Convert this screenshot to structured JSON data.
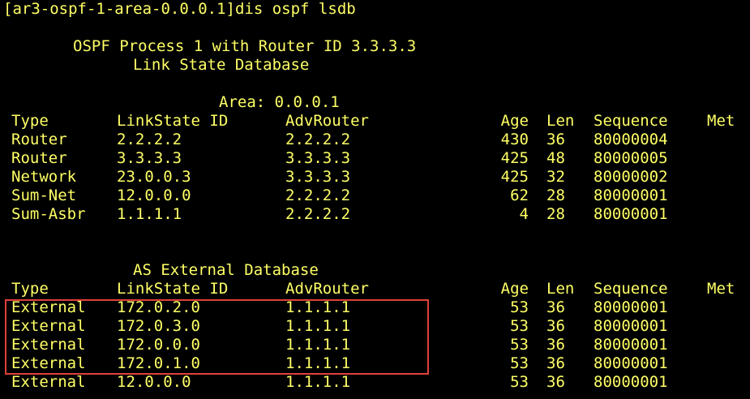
{
  "terminal": {
    "prompt": "[ar3-ospf-1-area-0.0.0.1]",
    "command": "dis ospf lsdb",
    "title_line": "OSPF Process 1 with Router ID 3.3.3.3",
    "subtitle_line": "Link State Database",
    "area_label": "Area:",
    "area_value": "0.0.0.1",
    "external_title": "AS External Database",
    "colors": {
      "background": "#000000",
      "text": "#ffff66",
      "highlight_border": "#e0403a"
    }
  },
  "columns": {
    "type": "Type",
    "lsid": "LinkState ID",
    "adv": "AdvRouter",
    "age": "Age",
    "len": "Len",
    "seq": "Sequence",
    "met": "Met"
  },
  "area_rows": [
    {
      "type": "Router",
      "lsid": "2.2.2.2",
      "adv": "2.2.2.2",
      "age": "430",
      "len": "36",
      "seq": "80000004"
    },
    {
      "type": "Router",
      "lsid": "3.3.3.3",
      "adv": "3.3.3.3",
      "age": "425",
      "len": "48",
      "seq": "80000005"
    },
    {
      "type": "Network",
      "lsid": "23.0.0.3",
      "adv": "3.3.3.3",
      "age": "425",
      "len": "32",
      "seq": "80000002"
    },
    {
      "type": "Sum-Net",
      "lsid": "12.0.0.0",
      "adv": "2.2.2.2",
      "age": "62",
      "len": "28",
      "seq": "80000001"
    },
    {
      "type": "Sum-Asbr",
      "lsid": "1.1.1.1",
      "adv": "2.2.2.2",
      "age": "4",
      "len": "28",
      "seq": "80000001"
    }
  ],
  "external_rows": [
    {
      "type": "External",
      "lsid": "172.0.2.0",
      "adv": "1.1.1.1",
      "age": "53",
      "len": "36",
      "seq": "80000001"
    },
    {
      "type": "External",
      "lsid": "172.0.3.0",
      "adv": "1.1.1.1",
      "age": "53",
      "len": "36",
      "seq": "80000001"
    },
    {
      "type": "External",
      "lsid": "172.0.0.0",
      "adv": "1.1.1.1",
      "age": "53",
      "len": "36",
      "seq": "80000001"
    },
    {
      "type": "External",
      "lsid": "172.0.1.0",
      "adv": "1.1.1.1",
      "age": "53",
      "len": "36",
      "seq": "80000001"
    },
    {
      "type": "External",
      "lsid": "12.0.0.0",
      "adv": "1.1.1.1",
      "age": "53",
      "len": "36",
      "seq": "80000001"
    }
  ]
}
